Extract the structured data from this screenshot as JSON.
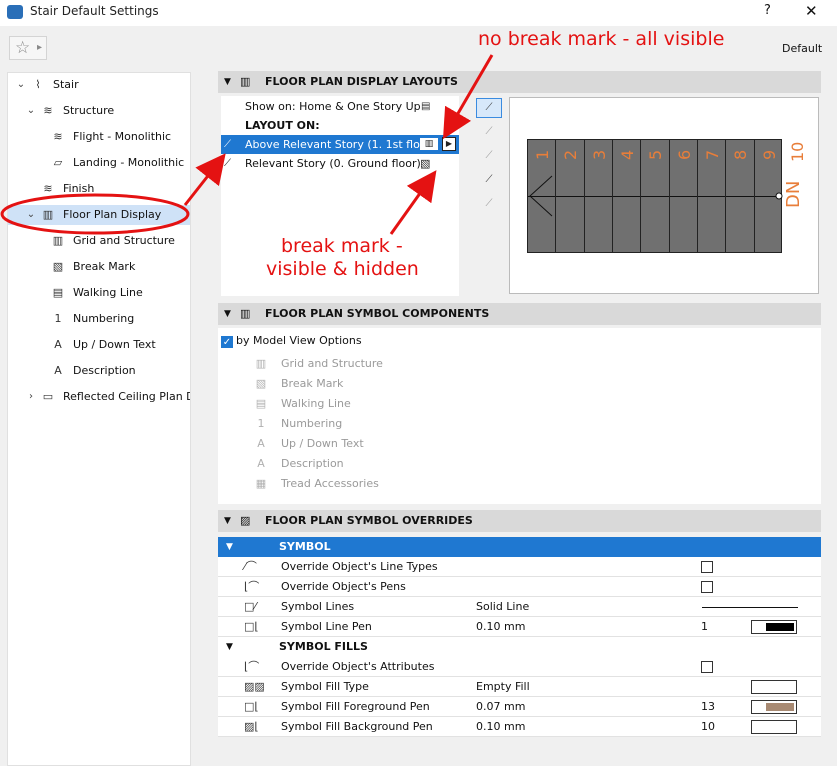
{
  "window": {
    "title": "Stair Default Settings",
    "help": "?",
    "close": "✕",
    "default_label": "Default"
  },
  "favorites": {
    "star": "☆",
    "arrow": "▸"
  },
  "tree": [
    {
      "label": "Stair",
      "toggle": "⌄",
      "icon": "stair-icon"
    },
    {
      "label": "Structure",
      "toggle": "⌄",
      "icon": "structure-icon"
    },
    {
      "label": "Flight - Monolithic",
      "icon": "flight-icon"
    },
    {
      "label": "Landing - Monolithic",
      "icon": "landing-icon"
    },
    {
      "label": "Finish",
      "icon": "finish-icon"
    },
    {
      "label": "Floor Plan Display",
      "toggle": "⌄",
      "icon": "floor-plan-icon",
      "selected": true
    },
    {
      "label": "Grid and Structure",
      "icon": "grid-icon"
    },
    {
      "label": "Break Mark",
      "icon": "break-mark-icon"
    },
    {
      "label": "Walking Line",
      "icon": "walking-line-icon"
    },
    {
      "label": "Numbering",
      "icon": "numbering-icon"
    },
    {
      "label": "Up / Down Text",
      "icon": "updown-text-icon"
    },
    {
      "label": "Description",
      "icon": "description-icon"
    },
    {
      "label": "Reflected Ceiling Plan Di",
      "toggle": "›",
      "icon": "rcp-icon"
    }
  ],
  "sections": {
    "layouts": "FLOOR PLAN DISPLAY LAYOUTS",
    "components": "FLOOR PLAN SYMBOL COMPONENTS",
    "overrides": "FLOOR PLAN SYMBOL OVERRIDES"
  },
  "layouts": {
    "show_on": "Show on: Home & One Story Up",
    "layout_on": "LAYOUT ON:",
    "items": [
      {
        "label": "Above Relevant Story (1. 1st flo...",
        "selected": true
      },
      {
        "label": "Relevant Story (0. Ground floor)",
        "selected": false
      }
    ]
  },
  "preview": {
    "numbers": [
      "1",
      "2",
      "3",
      "4",
      "5",
      "6",
      "7",
      "8",
      "9",
      "10"
    ],
    "dn": "DN"
  },
  "components": {
    "by_mvo": "by Model View Options",
    "items": [
      "Grid and Structure",
      "Break Mark",
      "Walking Line",
      "Numbering",
      "Up / Down Text",
      "Description",
      "Tread Accessories"
    ]
  },
  "overrides": {
    "symbol_header": "SYMBOL",
    "fills_header": "SYMBOL FILLS",
    "symbol_rows": [
      {
        "name": "Override Object's Line Types",
        "value": "",
        "col": "",
        "check": true
      },
      {
        "name": "Override Object's Pens",
        "value": "",
        "col": "",
        "check": true
      },
      {
        "name": "Symbol Lines",
        "value": "Solid Line",
        "col": "",
        "line": true
      },
      {
        "name": "Symbol Line Pen",
        "value": "0.10 mm",
        "col": "1",
        "swatch": "#000000"
      }
    ],
    "fill_rows": [
      {
        "name": "Override Object's Attributes",
        "value": "",
        "col": "",
        "check": true
      },
      {
        "name": "Symbol Fill Type",
        "value": "Empty Fill",
        "col": "",
        "swatch": "#ffffff"
      },
      {
        "name": "Symbol Fill Foreground Pen",
        "value": "0.07 mm",
        "col": "13",
        "swatch": "#a88a73"
      },
      {
        "name": "Symbol Fill Background Pen",
        "value": "0.10 mm",
        "col": "10",
        "swatch": "#ffffff"
      }
    ]
  },
  "annotations": {
    "top": "no break mark - all visible",
    "mid_line1": "break mark -",
    "mid_line2": "visible & hidden"
  },
  "colors": {
    "accent": "#1f78d1",
    "annotation": "#e41212",
    "numbers": "#e87e3a"
  }
}
